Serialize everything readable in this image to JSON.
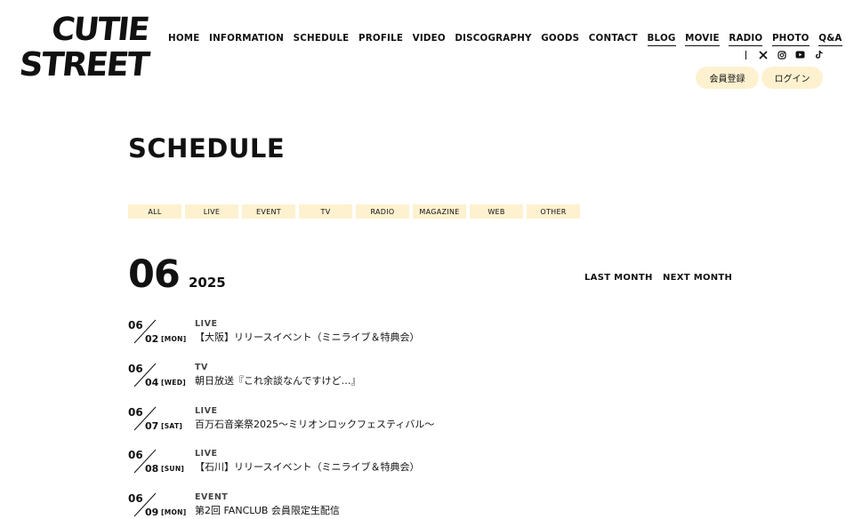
{
  "logo": {
    "line1": "CUTIE",
    "line2": "STREET"
  },
  "nav": [
    {
      "label": "HOME",
      "underline": false
    },
    {
      "label": "INFORMATION",
      "underline": false
    },
    {
      "label": "SCHEDULE",
      "underline": false
    },
    {
      "label": "PROFILE",
      "underline": false
    },
    {
      "label": "VIDEO",
      "underline": false
    },
    {
      "label": "DISCOGRAPHY",
      "underline": false
    },
    {
      "label": "GOODS",
      "underline": false
    },
    {
      "label": "CONTACT",
      "underline": false
    },
    {
      "label": "BLOG",
      "underline": true
    },
    {
      "label": "MOVIE",
      "underline": true
    },
    {
      "label": "RADIO",
      "underline": true
    },
    {
      "label": "PHOTO",
      "underline": true
    },
    {
      "label": "Q&A",
      "underline": true
    }
  ],
  "social_icons": [
    "x-icon",
    "instagram-icon",
    "youtube-icon",
    "tiktok-icon"
  ],
  "member": {
    "register": "会員登録",
    "login": "ログイン"
  },
  "page_title": "SCHEDULE",
  "filters": [
    "ALL",
    "LIVE",
    "EVENT",
    "TV",
    "RADIO",
    "MAGAZINE",
    "WEB",
    "OTHER"
  ],
  "calendar": {
    "month": "06",
    "year": "2025",
    "last": "LAST MONTH",
    "next": "NEXT MONTH"
  },
  "events": [
    {
      "month": "06",
      "day": "02",
      "dow": "[MON]",
      "category": "LIVE",
      "title": "【大阪】リリースイベント（ミニライブ＆特典会）"
    },
    {
      "month": "06",
      "day": "04",
      "dow": "[WED]",
      "category": "TV",
      "title": "朝日放送『これ余談なんですけど…』"
    },
    {
      "month": "06",
      "day": "07",
      "dow": "[SAT]",
      "category": "LIVE",
      "title": "百万石音楽祭2025〜ミリオンロックフェスティバル〜"
    },
    {
      "month": "06",
      "day": "08",
      "dow": "[SUN]",
      "category": "LIVE",
      "title": "【石川】リリースイベント（ミニライブ＆特典会）"
    },
    {
      "month": "06",
      "day": "09",
      "dow": "[MON]",
      "category": "EVENT",
      "title": "第2回 FANCLUB 会員限定生配信"
    }
  ],
  "colors": {
    "accent_bg": "#fdf1cf",
    "text": "#111111"
  }
}
